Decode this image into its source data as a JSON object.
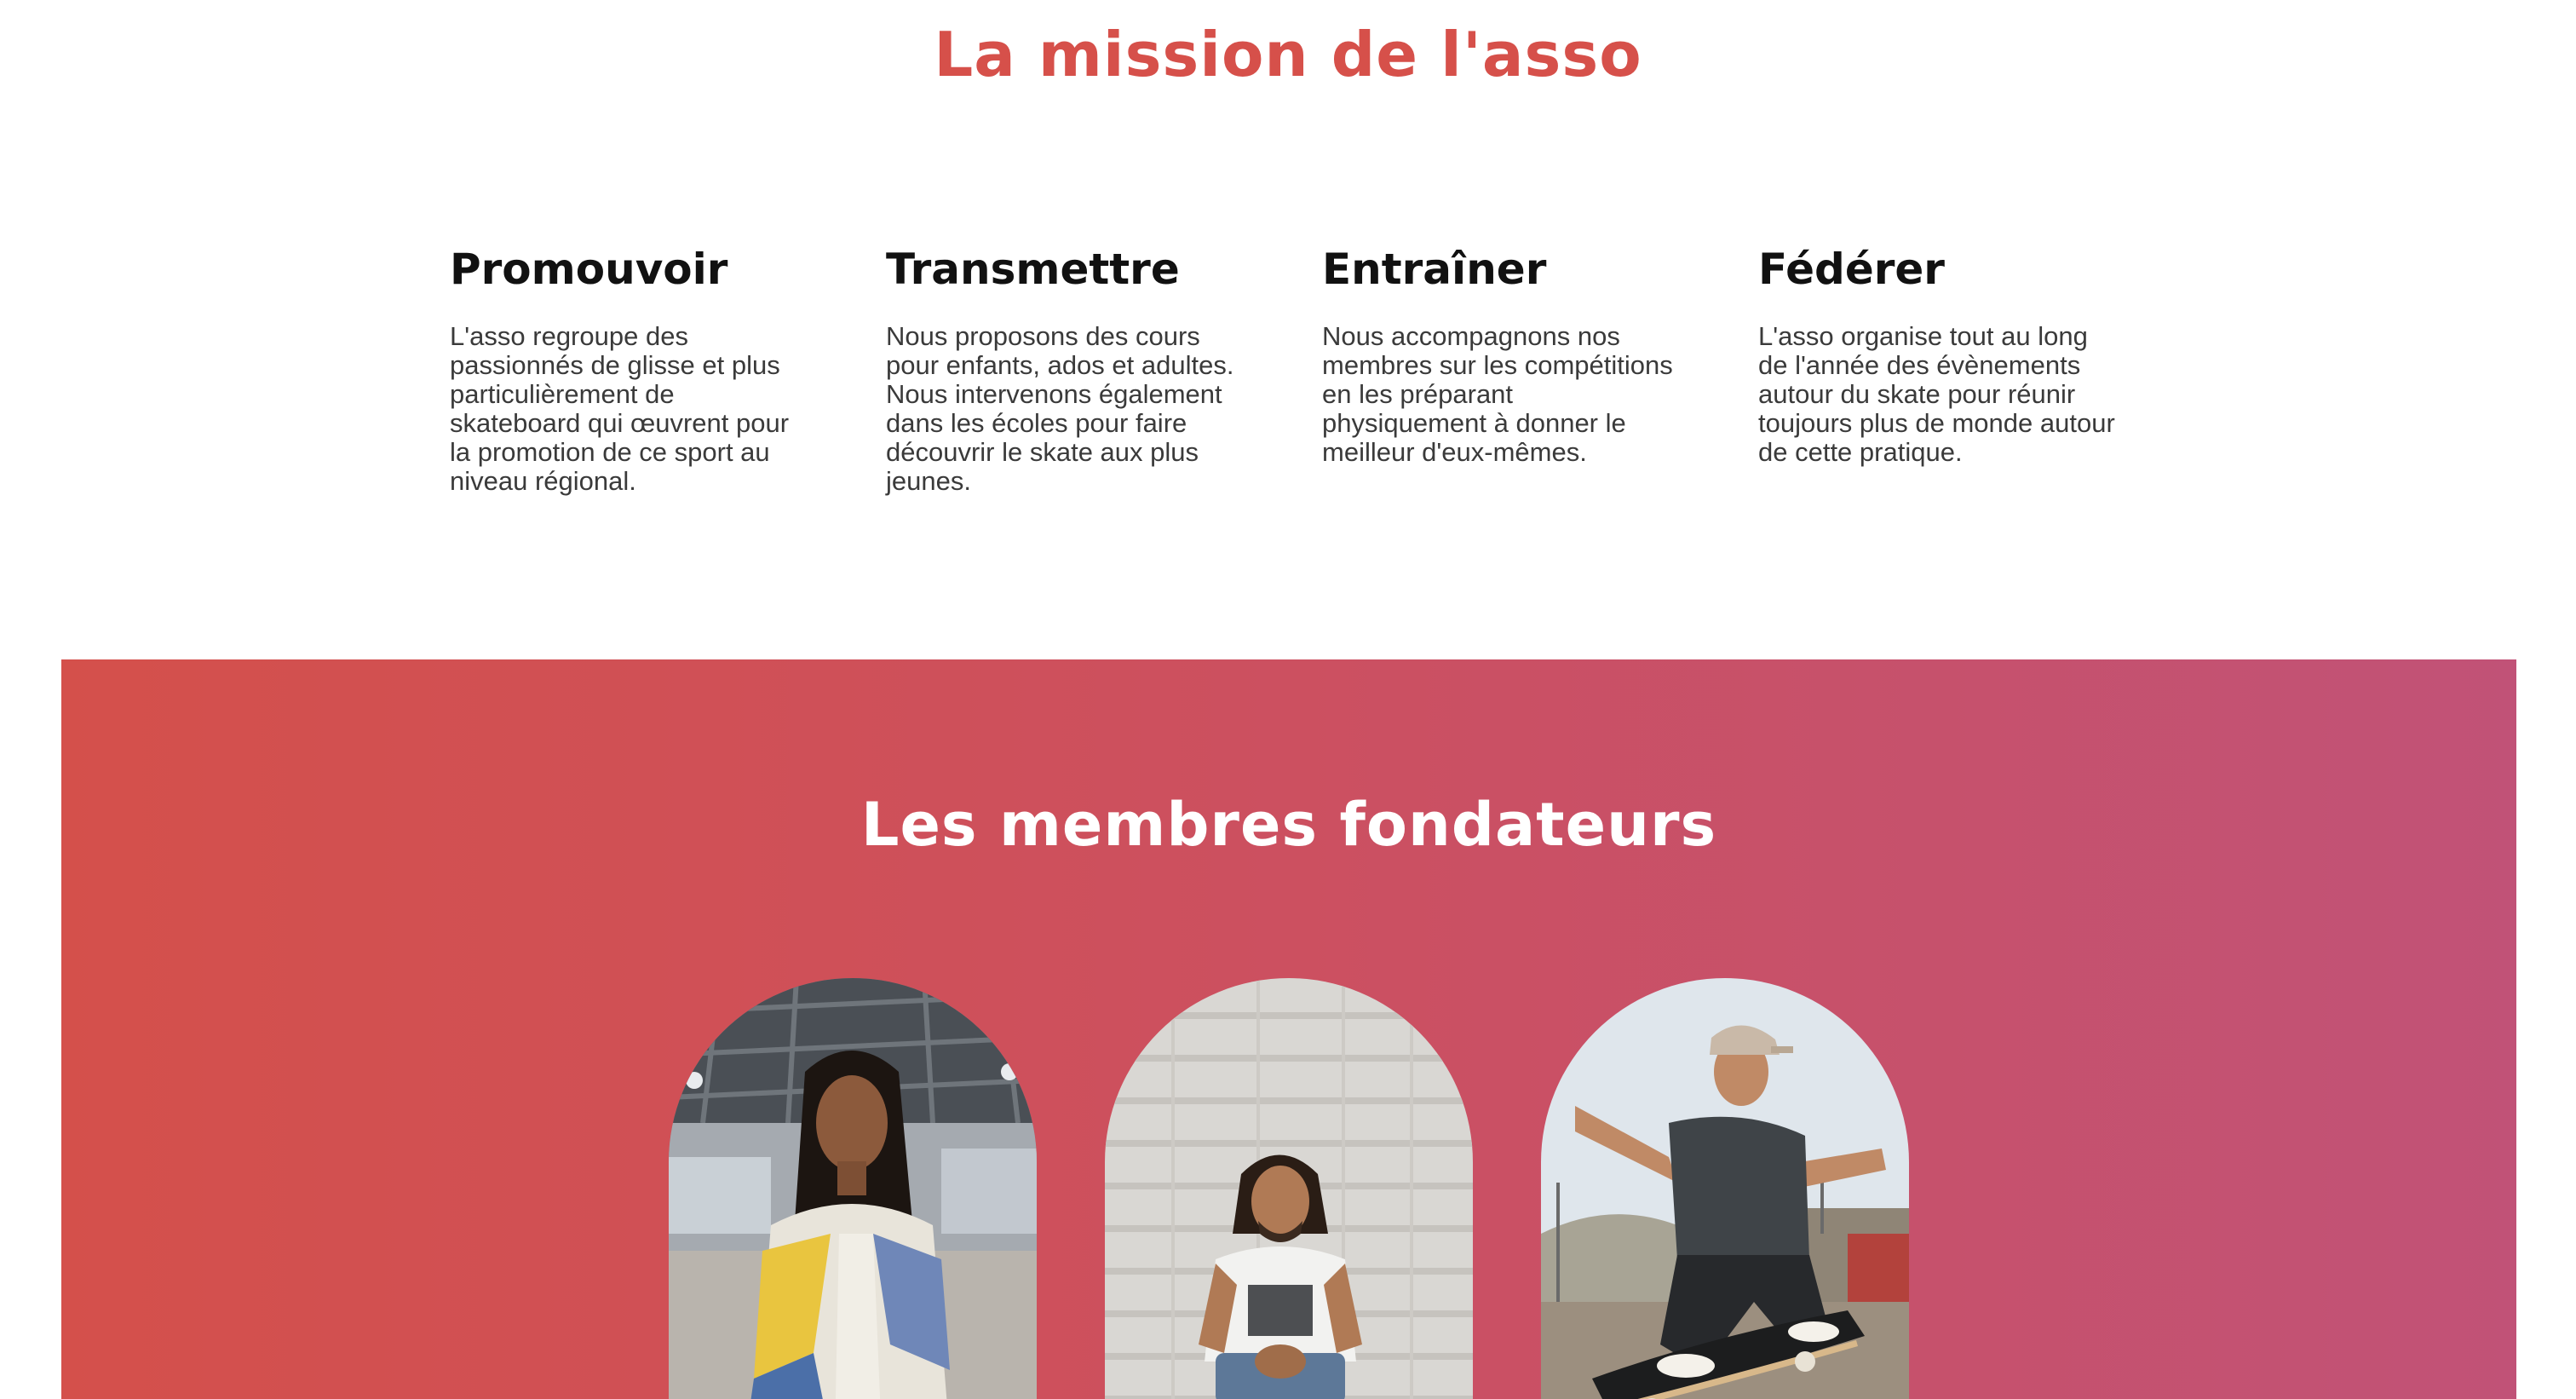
{
  "mission": {
    "title": "La mission de l'asso",
    "pillars": [
      {
        "title": "Promouvoir",
        "lines": [
          "L'asso regroupe des",
          "passionnés de glisse et plus",
          "particulièrement de",
          "skateboard qui œuvrent pour",
          "la promotion de ce sport au",
          "niveau régional."
        ]
      },
      {
        "title": "Transmettre",
        "lines": [
          "Nous proposons des cours",
          "pour enfants, ados et adultes.",
          "Nous intervenons également",
          "dans les écoles pour faire",
          "découvrir le skate aux plus",
          "jeunes."
        ]
      },
      {
        "title": "Entraîner",
        "lines": [
          "Nous accompagnons nos",
          "membres sur les compétitions",
          "en les préparant",
          "physiquement à donner le",
          "meilleur d'eux-mêmes."
        ]
      },
      {
        "title": "Fédérer",
        "lines": [
          "L'asso organise tout au long",
          "de l'année des évènements",
          "autour du skate pour réunir",
          "toujours plus de monde autour",
          "de cette pratique."
        ]
      }
    ]
  },
  "founders": {
    "title": "Les membres fondateurs"
  },
  "colors": {
    "accent": "#d6504a",
    "gradient_start": "#d4504b",
    "gradient_end": "#c15277"
  }
}
